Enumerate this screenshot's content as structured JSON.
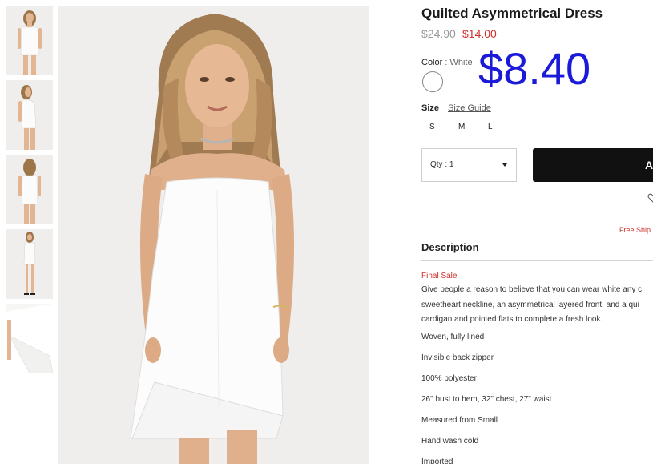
{
  "product": {
    "title": "Quilted Asymmetrical Dress",
    "original_price": "$24.90",
    "sale_price": "$14.00",
    "overlay_price": "$8.40",
    "color": {
      "label": "Color",
      "separator": ":",
      "value": "White",
      "swatch_color": "#ffffff"
    },
    "size": {
      "label": "Size",
      "guide_link": "Size Guide",
      "options": [
        "S",
        "M",
        "L"
      ]
    },
    "quantity": {
      "label": "Qty : 1"
    },
    "add_button_label": "A",
    "free_shipping_text": "Free Ship",
    "description": {
      "heading": "Description",
      "final_sale": "Final Sale",
      "body_lines": [
        "Give people a reason to believe that you can wear white any c",
        "sweetheart neckline, an asymmetrical layered front, and a qui",
        "cardigan and pointed flats to complete a fresh look."
      ],
      "details": [
        "Woven, fully lined",
        "Invisible back zipper",
        "100% polyester",
        "26\" bust to hem, 32\" chest, 27\" waist",
        "Measured from Small",
        "Hand wash cold",
        "Imported"
      ]
    }
  },
  "colors": {
    "accent_red": "#d0312d",
    "overlay_blue": "#1a1ad8",
    "button_black": "#111111"
  },
  "icons": {
    "heart": "heart-icon",
    "dropdown": "chevron-down-icon"
  }
}
